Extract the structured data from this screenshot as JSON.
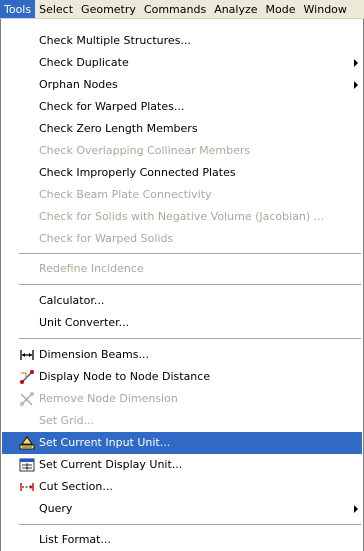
{
  "menubar": {
    "items": [
      "Tools",
      "Select",
      "Geometry",
      "Commands",
      "Analyze",
      "Mode",
      "Window"
    ]
  },
  "menu": {
    "check_multiple": "Check Multiple Structures...",
    "check_duplicate": "Check Duplicate",
    "orphan_nodes": "Orphan Nodes",
    "check_warped_plates": "Check for Warped Plates...",
    "check_zero_length": "Check Zero Length Members",
    "check_overlapping": "Check Overlapping Collinear Members",
    "check_improperly": "Check Improperly Connected Plates",
    "check_beam_plate": "Check Beam Plate Connectivity",
    "check_solids_negative": "Check for Solids with Negative Volume (Jacobian) ...",
    "check_warped_solids": "Check for Warped Solids",
    "redefine_incidence": "Redefine Incidence",
    "calculator": "Calculator...",
    "unit_converter": "Unit Converter...",
    "dimension_beams": "Dimension Beams...",
    "display_node_distance": "Display Node to Node Distance",
    "remove_node_dimension": "Remove Node Dimension",
    "set_grid": "Set Grid...",
    "set_current_input_unit": "Set Current Input Unit...",
    "set_current_display_unit": "Set Current Display Unit...",
    "cut_section": "Cut Section...",
    "query": "Query",
    "list_format": "List Format..."
  }
}
